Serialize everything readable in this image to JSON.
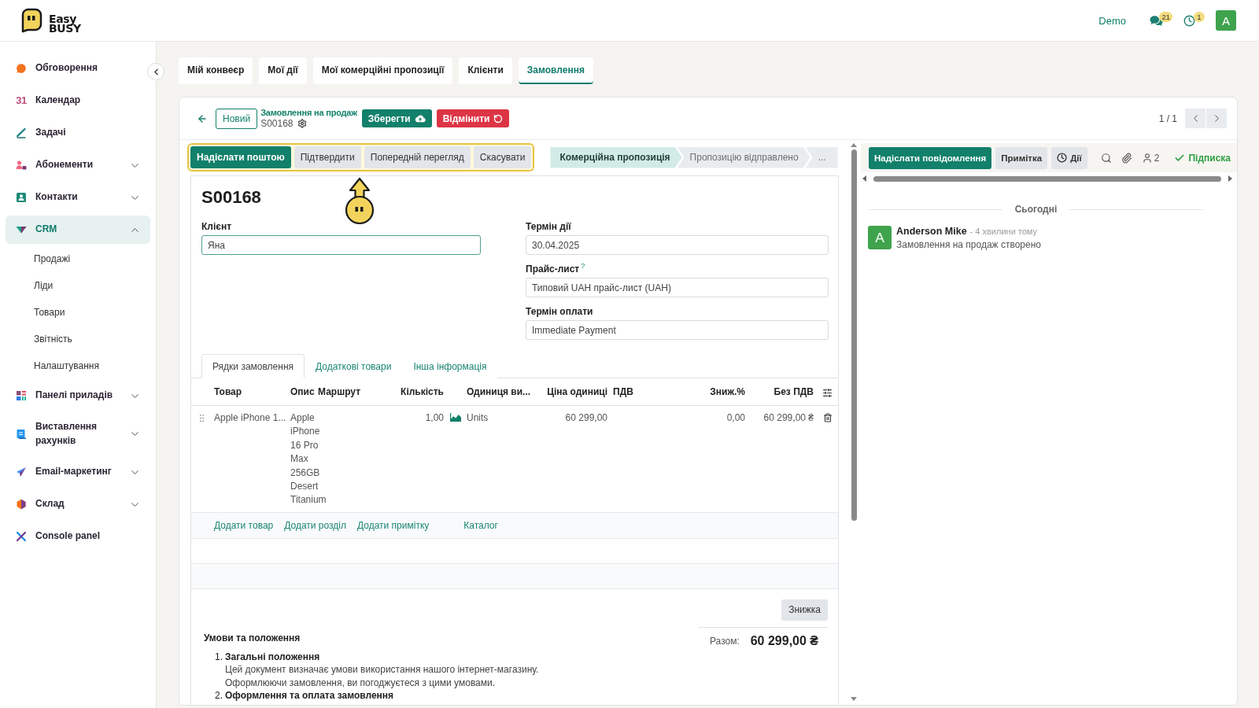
{
  "header": {
    "logo": {
      "top": "Easy",
      "bottom": "BUSY"
    },
    "company": "Demo",
    "indicators": [
      {
        "kind": "messages",
        "count": "21"
      },
      {
        "kind": "activities",
        "count": "1"
      }
    ],
    "avatar": "A"
  },
  "sidebar": {
    "items": [
      {
        "kind": "link",
        "label": "Обговорення",
        "selected": false
      },
      {
        "kind": "link",
        "label": "Календар",
        "icon_text": "31",
        "selected": false
      },
      {
        "kind": "link",
        "label": "Задачі",
        "selected": false
      },
      {
        "kind": "group",
        "label": "Абонементи",
        "selected": false,
        "expanded": false
      },
      {
        "kind": "group",
        "label": "Контакти",
        "selected": false,
        "expanded": false
      },
      {
        "kind": "group",
        "label": "CRM",
        "selected": true,
        "expanded": true,
        "children": [
          {
            "label": "Продажі",
            "selected": false
          },
          {
            "label": "Ліди",
            "selected": false
          },
          {
            "label": "Товари",
            "selected": false
          },
          {
            "label": "Звітність",
            "selected": false
          },
          {
            "label": "Налаштування",
            "selected": false
          }
        ]
      },
      {
        "kind": "group",
        "label": "Панелі приладів",
        "selected": false,
        "expanded": false
      },
      {
        "kind": "group",
        "label": "Виставлення рахунків",
        "selected": false,
        "expanded": false
      },
      {
        "kind": "group",
        "label": "Email-маркетинг",
        "selected": false,
        "expanded": false
      },
      {
        "kind": "group",
        "label": "Склад",
        "selected": false,
        "expanded": false
      },
      {
        "kind": "link",
        "label": "Console panel",
        "selected": false
      }
    ]
  },
  "tabs": [
    {
      "label": "Мій конвеєр",
      "selected": false
    },
    {
      "label": "Мої дії",
      "selected": false
    },
    {
      "label": "Мої комерційні пропозиції",
      "selected": false
    },
    {
      "label": "Клієнти",
      "selected": false
    },
    {
      "label": "Замовлення",
      "selected": true
    }
  ],
  "control_panel": {
    "new_button": "Новий",
    "breadcrumb": "Замовлення на продаж",
    "record": "S00168",
    "save_button": "Зберегти",
    "discard_button": "Відмінити",
    "pager": "1 / 1"
  },
  "status_bar": {
    "highlighted": true,
    "actions": [
      {
        "label": "Надіслати поштою",
        "primary": true
      },
      {
        "label": "Підтвердити",
        "primary": false
      },
      {
        "label": "Попередній перегляд",
        "primary": false
      },
      {
        "label": "Скасувати",
        "primary": false
      }
    ],
    "stages": [
      {
        "label": "Комерційна пропозиція",
        "selected": true
      },
      {
        "label": "Пропозицію відправлено",
        "selected": false
      }
    ],
    "more": "..."
  },
  "form": {
    "title": "S00168",
    "left_fields": [
      {
        "label": "Клієнт",
        "value": "Яна",
        "focused": true
      }
    ],
    "right_fields": [
      {
        "label": "Термін дії",
        "value": "30.04.2025",
        "focused": false
      },
      {
        "label": "Прайс-лист",
        "help": "?",
        "value": "Типовий UAH прайс-лист (UAH)",
        "focused": false
      },
      {
        "label": "Термін оплати",
        "value": "Immediate Payment",
        "focused": false
      }
    ],
    "notebook_tabs": [
      {
        "label": "Рядки замовлення",
        "selected": true
      },
      {
        "label": "Додаткові товари",
        "selected": false
      },
      {
        "label": "Інша інформація",
        "selected": false
      }
    ],
    "order_lines": {
      "columns": [
        {
          "label": "Товар",
          "kind": "text"
        },
        {
          "label": "Опис",
          "kind": "text"
        },
        {
          "label": "Маршрут",
          "kind": "text"
        },
        {
          "label": "Кількість",
          "kind": "number"
        },
        {
          "label": "Одиниця ви...",
          "kind": "text"
        },
        {
          "label": "Ціна одиниці",
          "kind": "number"
        },
        {
          "label": "ПДВ",
          "kind": "text"
        },
        {
          "label": "Зниж.%",
          "kind": "number"
        },
        {
          "label": "Без ПДВ",
          "kind": "number"
        }
      ],
      "rows": [
        {
          "product": "Apple iPhone 1...",
          "description": "Apple iPhone 16 Pro Max 256GB Desert Titanium",
          "quantity": "1,00",
          "unit": "Units",
          "unit_price": "60 299,00",
          "discount": "0,00",
          "subtotal": "60 299,00 ₴"
        }
      ],
      "add_links": [
        {
          "kind": "add",
          "label": "Додати товар"
        },
        {
          "kind": "add",
          "label": "Додати розділ"
        },
        {
          "kind": "add",
          "label": "Додати примітку"
        },
        {
          "kind": "catalog",
          "label": "Каталог"
        }
      ]
    },
    "discount_button": "Знижка",
    "terms": {
      "title": "Умови та положення",
      "sections": [
        {
          "number": "1.",
          "title": "Загальні положення",
          "lines": [
            "Цей документ визначає умови використання нашого інтернет-магазину.",
            "Оформлюючи замовлення, ви погоджуєтеся з цими умовами."
          ]
        },
        {
          "number": "2.",
          "title": "Оформлення та оплата замовлення"
        }
      ]
    },
    "total": {
      "label": "Разом:",
      "value": "60 299,00 ₴"
    }
  },
  "chatter": {
    "buttons": [
      {
        "kind": "send",
        "label": "Надіслати повідомлення",
        "primary": true
      },
      {
        "kind": "note",
        "label": "Примітка",
        "primary": false
      },
      {
        "kind": "activity",
        "label": "Дії",
        "primary": false
      }
    ],
    "followers": "2",
    "follow": {
      "label": "Підписка",
      "following": true
    },
    "date_divider": "Сьогодні",
    "messages": [
      {
        "avatar": "A",
        "author": "Anderson Mike",
        "time": "- 4 хвилини тому",
        "body": "Замовлення на продаж створено"
      }
    ]
  }
}
